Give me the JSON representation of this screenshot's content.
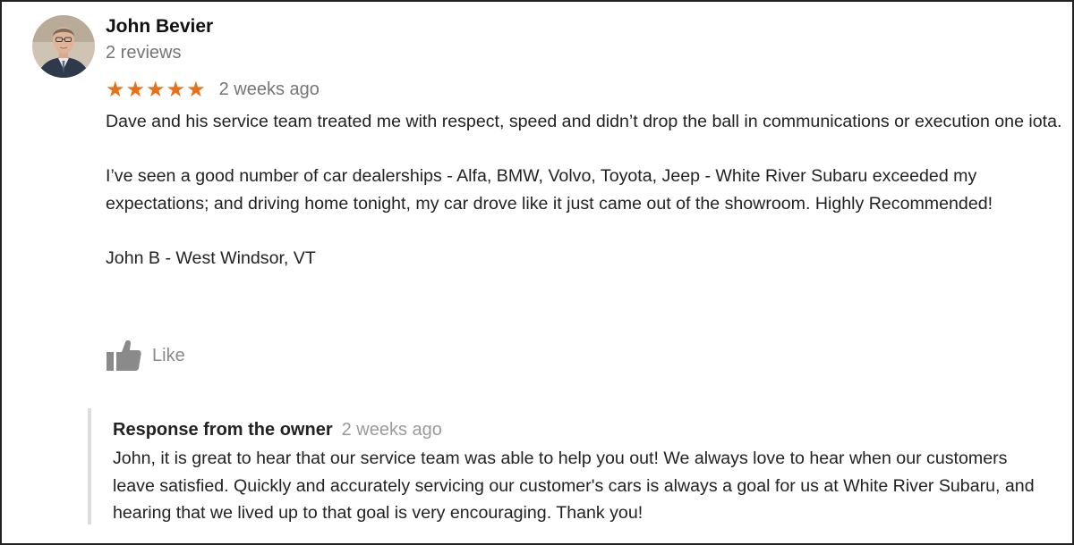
{
  "reviewer": {
    "name": "John Bevier",
    "review_count": "2 reviews",
    "avatar": "reviewer-photo"
  },
  "review": {
    "rating": 5,
    "rating_max": 5,
    "star_color": "#e7711b",
    "date": "2 weeks ago",
    "paragraphs": [
      "Dave and his service team treated me with respect, speed and didn’t drop the ball in communications or execution one iota.",
      "I’ve seen a good number of car dealerships - Alfa, BMW, Volvo, Toyota, Jeep - White River Subaru exceeded my expectations; and driving home tonight, my car drove like it just came out of the showroom. Highly Recommended!",
      "John B - West Windsor, VT"
    ]
  },
  "actions": {
    "like_label": "Like",
    "like_icon": "thumbs-up-icon"
  },
  "owner_response": {
    "title": "Response from the owner",
    "date": "2 weeks ago",
    "text": "John, it is great to hear that our service team was able to help you out! We always love to hear when our customers leave satisfied. Quickly and accurately servicing our customer's cars is always a goal for us at White River Subaru, and hearing that we lived up to that goal is very encouraging. Thank you!"
  }
}
